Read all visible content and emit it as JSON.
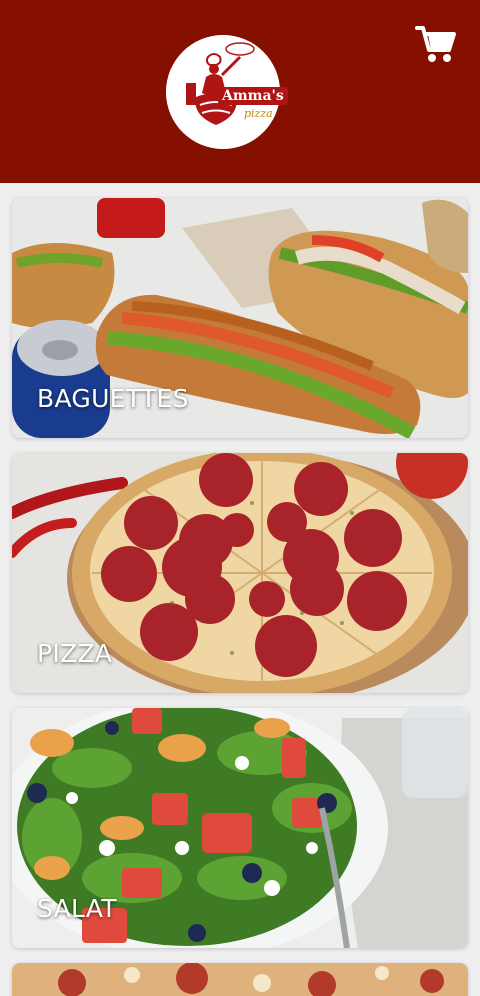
{
  "header": {
    "logo_text": "Amma's",
    "logo_subtext": "pizza",
    "cart_icon": "shopping-cart-icon",
    "background": "#851000"
  },
  "categories": [
    {
      "label": "BAGUETTES",
      "image": "baguette-sandwiches"
    },
    {
      "label": "PIZZA",
      "image": "pepperoni-pizza"
    },
    {
      "label": "SALAT",
      "image": "salad-bowl"
    },
    {
      "label": "",
      "image": "pizza-partial"
    }
  ]
}
